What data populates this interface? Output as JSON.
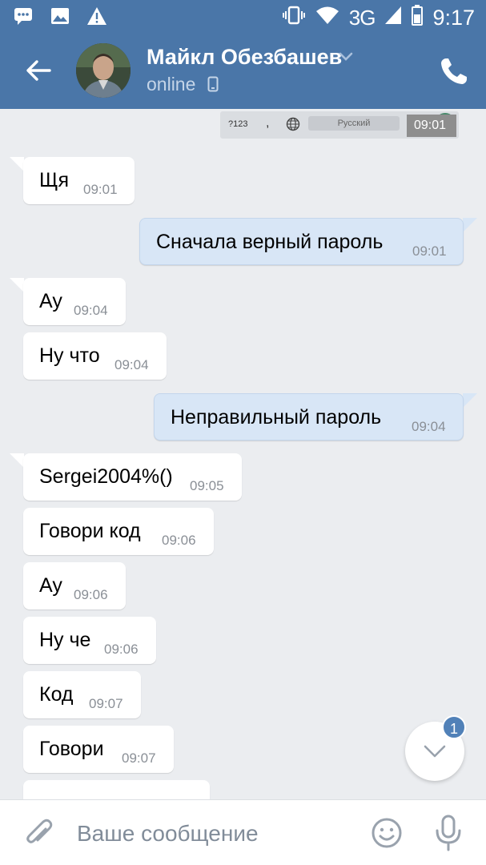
{
  "status_bar": {
    "time": "9:17",
    "network": "3G",
    "left_icons": [
      "chat-notification-icon",
      "image-notification-icon",
      "warning-icon"
    ],
    "right_icons": [
      "vibrate-icon",
      "wifi-icon",
      "signal-icon",
      "battery-icon"
    ]
  },
  "header": {
    "name": "Майкл Обезбашев",
    "status": "online"
  },
  "keyboard_strip": {
    "mode_key": "?123",
    "comma_key": ",",
    "space_label": "Русский",
    "time": "09:01"
  },
  "messages": [
    {
      "dir": "in",
      "text": "Щя",
      "time": "09:01"
    },
    {
      "dir": "out",
      "text": "Сначала верный пароль",
      "time": "09:01"
    },
    {
      "dir": "in",
      "text": "Ау",
      "time": "09:04"
    },
    {
      "dir": "in",
      "text": "Ну что",
      "time": "09:04"
    },
    {
      "dir": "out",
      "text": "Неправильный пароль",
      "time": "09:04"
    },
    {
      "dir": "in",
      "text": "Sergei2004%()",
      "time": "09:05"
    },
    {
      "dir": "in",
      "text": "Говори код",
      "time": "09:06"
    },
    {
      "dir": "in",
      "text": "Ау",
      "time": "09:06"
    },
    {
      "dir": "in",
      "text": "Ну че",
      "time": "09:06"
    },
    {
      "dir": "in",
      "text": "Код",
      "time": "09:07"
    },
    {
      "dir": "in",
      "text": "Говори",
      "time": "09:07"
    }
  ],
  "unread_badge": "1",
  "composer": {
    "placeholder": "Ваше сообщение"
  },
  "colors": {
    "header": "#4a76a8",
    "background": "#ebedf0",
    "outgoing_bubble": "#d8e6f6",
    "badge": "#5181b8"
  }
}
